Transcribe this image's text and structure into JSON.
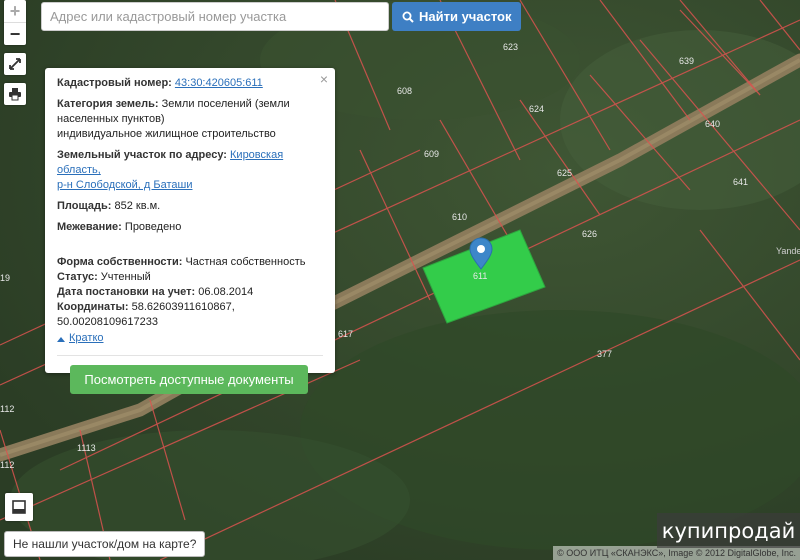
{
  "search": {
    "placeholder": "Адрес или кадастровый номер участка",
    "button_label": "Найти участок"
  },
  "map_controls": {
    "zoom_in": "+",
    "zoom_out": "−"
  },
  "parcel_labels": [
    "623",
    "639",
    "608",
    "624",
    "640",
    "609",
    "625",
    "641",
    "610",
    "626",
    "611",
    "617",
    "377",
    "1113",
    "1113",
    "112",
    "112",
    "19"
  ],
  "popup": {
    "close": "×",
    "cadastral_label": "Кадастровый номер:",
    "cadastral_value": "43:30:420605:611",
    "category_label": "Категория земель:",
    "category_value_1": "Земли поселений (земли",
    "category_value_2": "населенных пунктов)",
    "category_value_3": "индивидуальное жилищное строительство",
    "address_label": "Земельный участок по адресу:",
    "address_value_1": "Кировская область,",
    "address_value_2": "р-н Слободской, д Баташи",
    "area_label": "Площадь:",
    "area_value": "852 кв.м.",
    "survey_label": "Межевание:",
    "survey_value": "Проведено",
    "ownership_label": "Форма собственности:",
    "ownership_value": "Частная собственность",
    "status_label": "Статус:",
    "status_value": "Учтенный",
    "date_label": "Дата постановки на учет:",
    "date_value": "06.08.2014",
    "coords_label": "Координаты:",
    "coords_value": "58.62603911610867, 50.00208109617233",
    "collapse_label": "Кратко",
    "docs_button": "Посмотреть доступные документы"
  },
  "not_found_button": "Не нашли участок/дом на карте?",
  "attribution": "© ООО ИТЦ «СКАНЭКС», Image © 2012 DigitalGlobe, Inc.",
  "map_watermark": "Yandex",
  "watermark": "купипродай",
  "colors": {
    "highlight": "#33cc4a",
    "marker": "#3d86c9",
    "boundary": "#d9534f",
    "search_button": "#3e7fc4",
    "docs_button": "#5cb85c"
  }
}
